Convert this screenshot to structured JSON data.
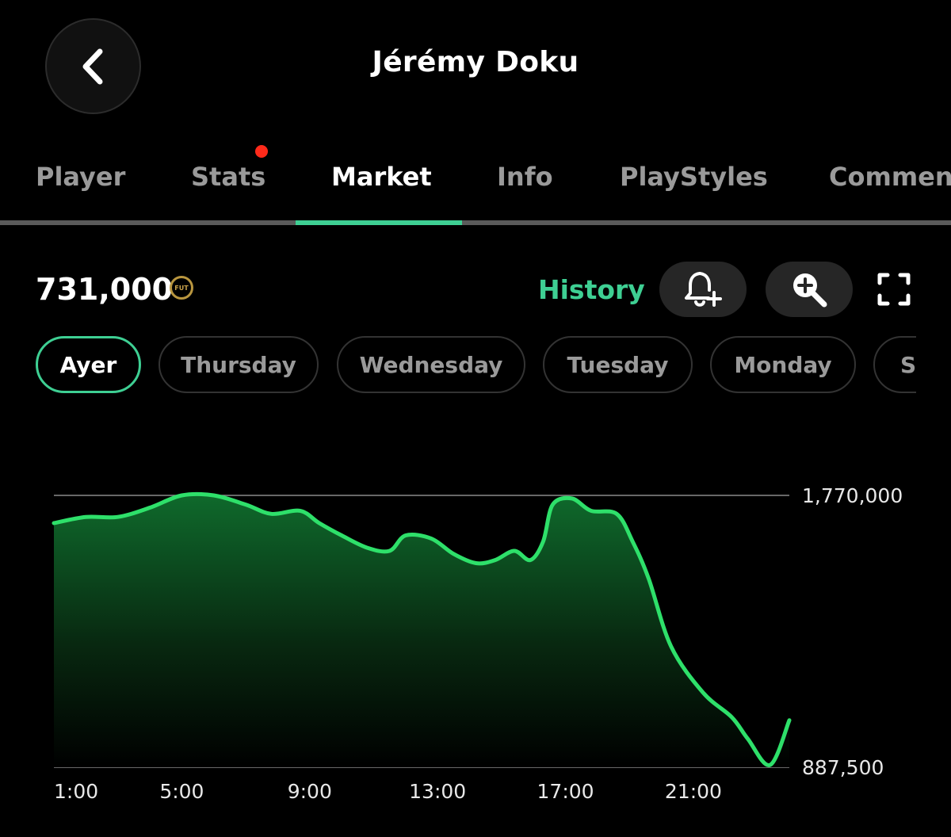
{
  "header": {
    "title": "Jérémy Doku",
    "back_icon": "chevron-left-icon"
  },
  "tabs": [
    {
      "label": "Player",
      "active": false
    },
    {
      "label": "Stats",
      "active": false,
      "has_notification": true
    },
    {
      "label": "Market",
      "active": true
    },
    {
      "label": "Info",
      "active": false
    },
    {
      "label": "PlayStyles",
      "active": false
    },
    {
      "label": "Comments",
      "active": false
    }
  ],
  "market": {
    "price": "731,000",
    "coin_label": "FUT",
    "history_label": "History",
    "icons": [
      "bell-plus-icon",
      "zoom-in-icon",
      "fullscreen-icon"
    ]
  },
  "day_chips": [
    {
      "label": "Ayer",
      "active": true
    },
    {
      "label": "Thursday",
      "active": false
    },
    {
      "label": "Wednesday",
      "active": false
    },
    {
      "label": "Tuesday",
      "active": false
    },
    {
      "label": "Monday",
      "active": false
    },
    {
      "label": "Su",
      "active": false
    }
  ],
  "colors": {
    "accent": "#3ecf93",
    "line": "#2ee06a",
    "notification": "#ff2a1a",
    "background": "#000000"
  },
  "chart_data": {
    "type": "area",
    "x_ticks": [
      "1:00",
      "5:00",
      "9:00",
      "13:00",
      "17:00",
      "21:00"
    ],
    "y_ticks": [
      "1,770,000",
      "887,500"
    ],
    "ylim": [
      887500,
      1770000
    ],
    "xlim": [
      1,
      24
    ],
    "grid": true,
    "series": [
      {
        "x": [
          1,
          2,
          3,
          4,
          5,
          6,
          7,
          7.8,
          8.7,
          9.3,
          10,
          10.8,
          11.5,
          12,
          12.8,
          13.5,
          14.2,
          14.8,
          15.4,
          15.9,
          16.3,
          16.6,
          17.2,
          17.8,
          18.6,
          19.1,
          19.6,
          20.3,
          21.3,
          22.2,
          22.7,
          23.4,
          24
        ],
        "y": [
          1680000,
          1700000,
          1700000,
          1730000,
          1770000,
          1770000,
          1740000,
          1710000,
          1720000,
          1680000,
          1640000,
          1600000,
          1590000,
          1640000,
          1630000,
          1580000,
          1550000,
          1560000,
          1590000,
          1560000,
          1620000,
          1740000,
          1760000,
          1720000,
          1710000,
          1620000,
          1500000,
          1280000,
          1130000,
          1050000,
          980000,
          895000,
          1040000
        ]
      }
    ]
  }
}
